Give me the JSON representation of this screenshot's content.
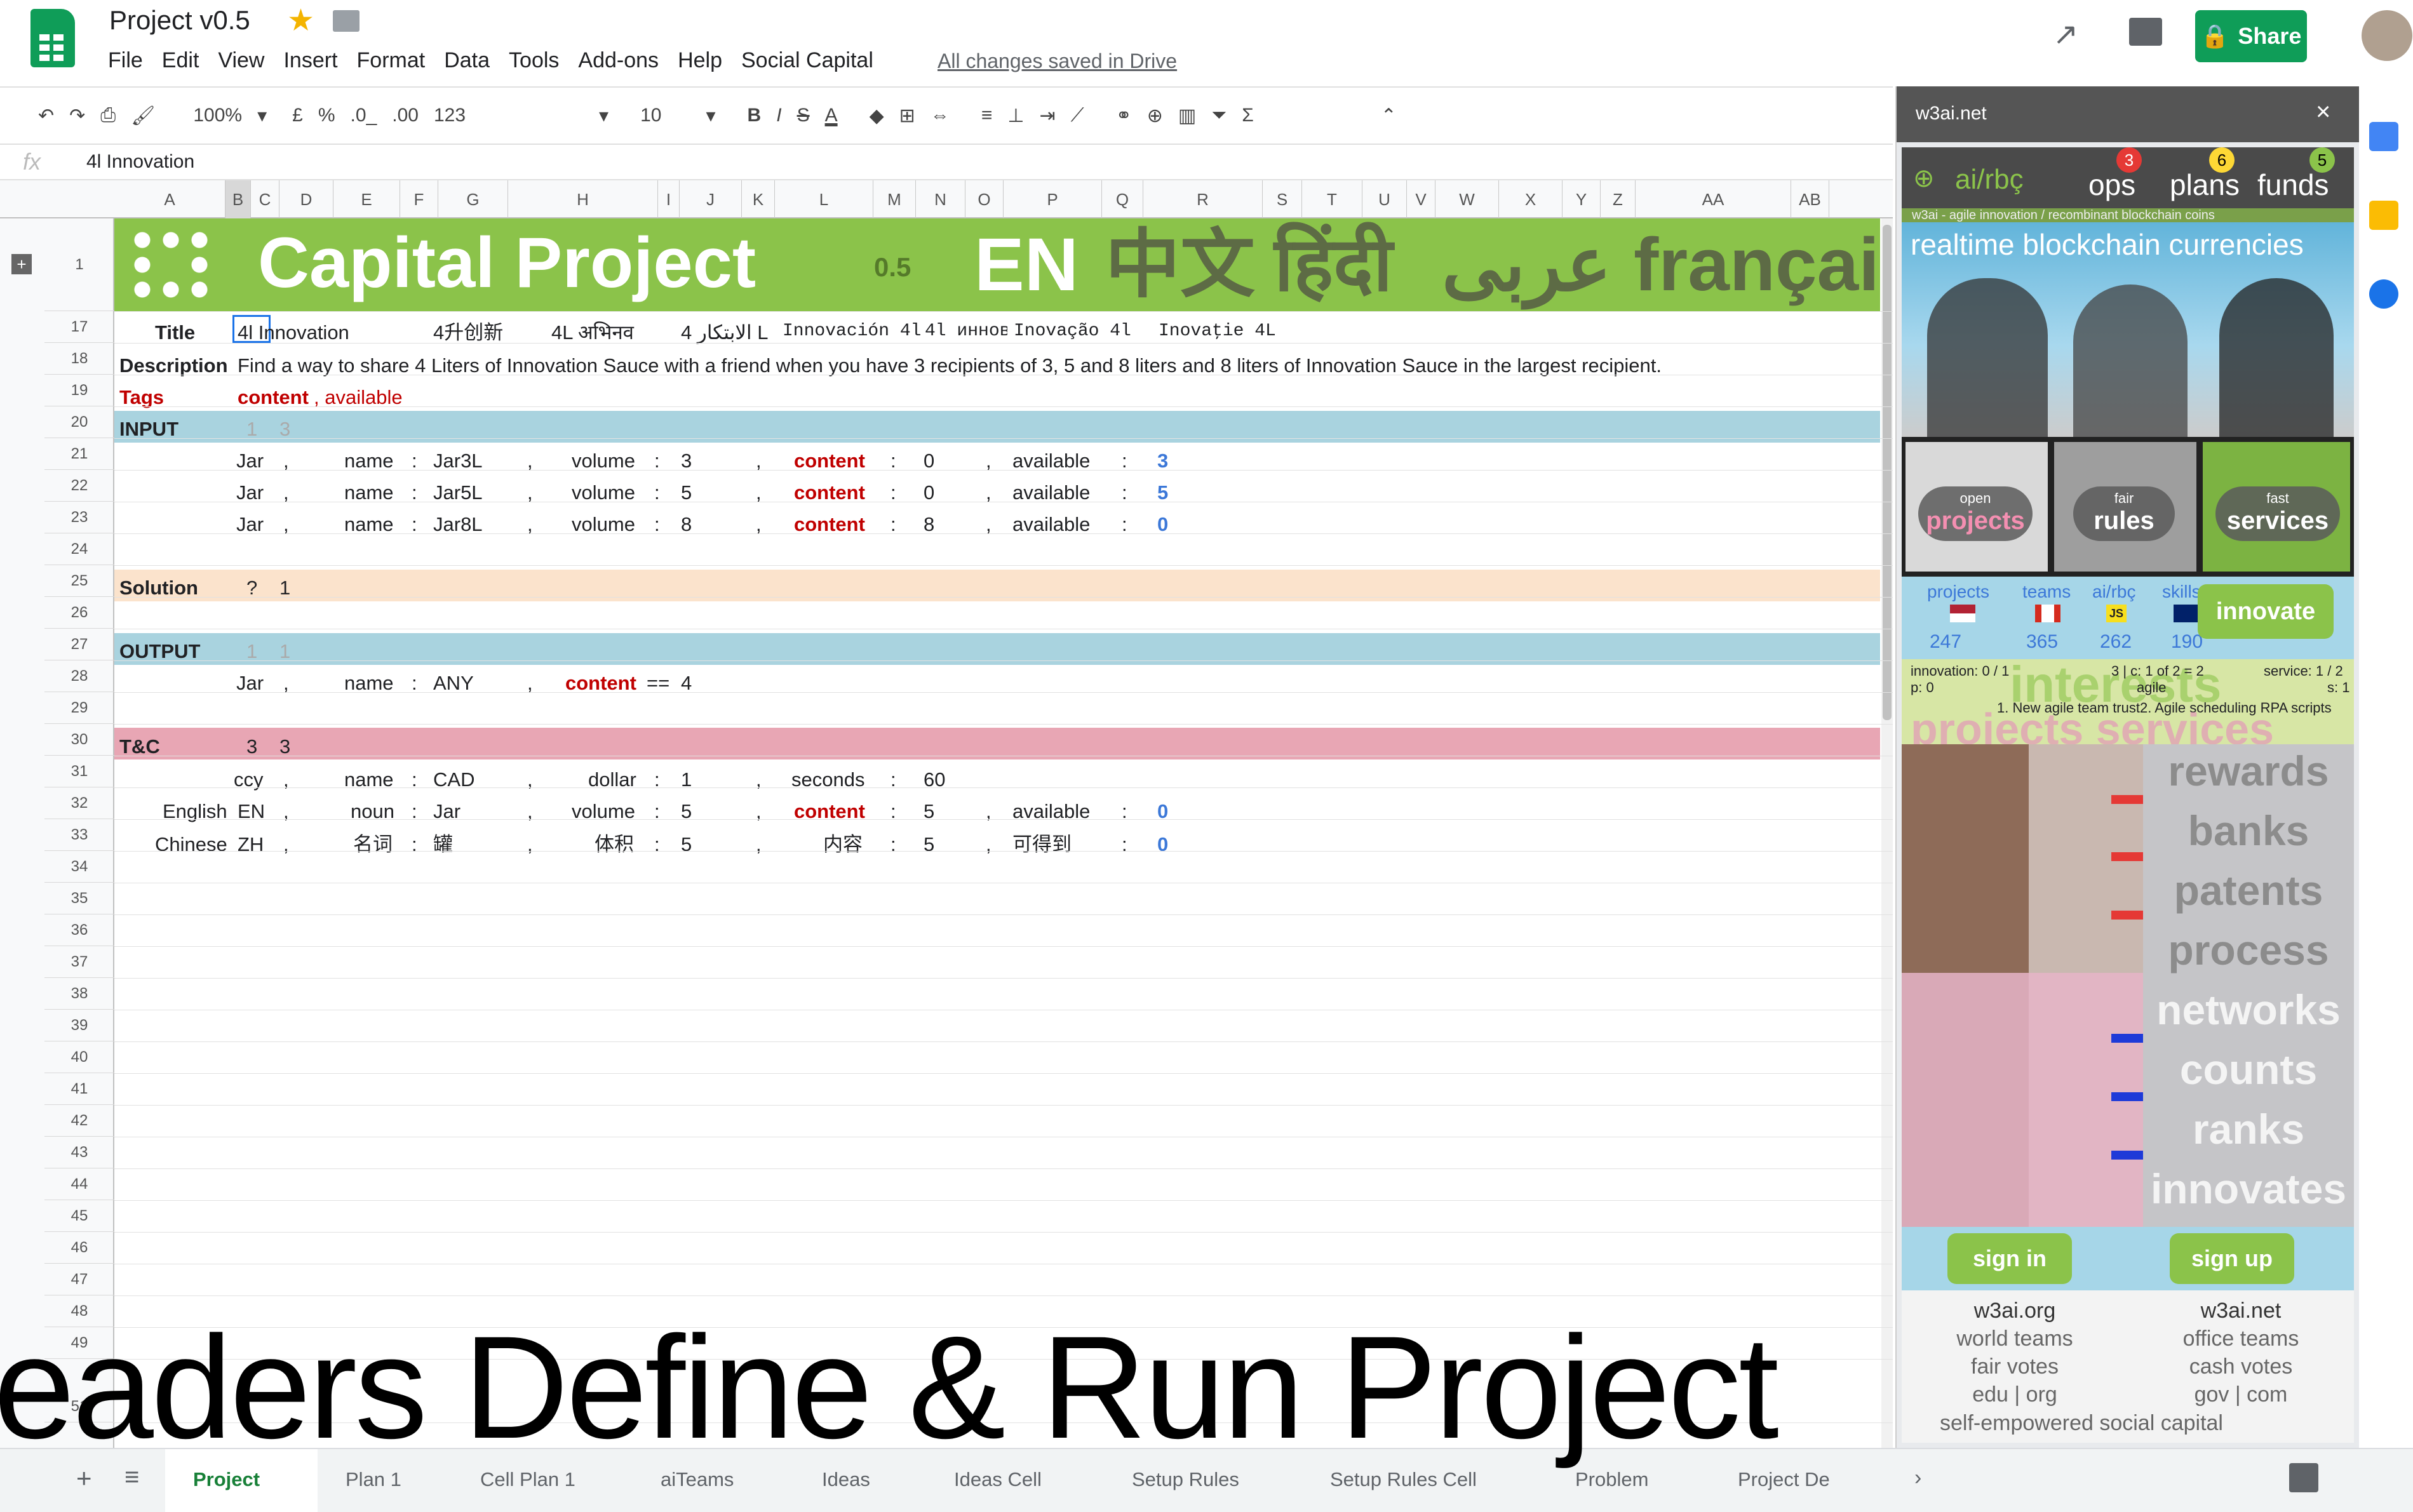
{
  "header": {
    "doc_title": "Project v0.5",
    "menus": [
      "File",
      "Edit",
      "View",
      "Insert",
      "Format",
      "Data",
      "Tools",
      "Add-ons",
      "Help",
      "Social Capital"
    ],
    "saved_status": "All changes saved in Drive",
    "share_label": "Share"
  },
  "toolbar": {
    "zoom": "100%",
    "currency": "£",
    "percent": "%",
    "dec_less": ".0_",
    "dec_more": ".00",
    "format_num": "123",
    "font_size": "10",
    "bold": "B",
    "italic": "I",
    "strike": "S",
    "text_color": "A",
    "sum": "Σ"
  },
  "formula_bar": {
    "fx": "fx",
    "value": "4l Innovation"
  },
  "columns": [
    "A",
    "B",
    "C",
    "D",
    "E",
    "F",
    "G",
    "H",
    "I",
    "J",
    "K",
    "L",
    "M",
    "N",
    "O",
    "P",
    "Q",
    "R",
    "S",
    "T",
    "U",
    "V",
    "W",
    "X",
    "Y",
    "Z",
    "AA",
    "AB"
  ],
  "banner": {
    "title": "Capital Project",
    "version": "0.5",
    "langs": [
      "EN",
      "中文",
      "हिंदी",
      "عربى",
      "françai"
    ]
  },
  "rows": {
    "r1": "1",
    "r17": "17",
    "r18": "18",
    "r19": "19",
    "r20": "20",
    "r21": "21",
    "r22": "22",
    "r23": "23",
    "r24": "24",
    "r25": "25",
    "r26": "26",
    "r27": "27",
    "r28": "28",
    "r29": "29",
    "r30": "30",
    "r31": "31",
    "r32": "32",
    "r33": "33",
    "r34": "34",
    "r35": "35",
    "r36": "36",
    "r37": "37",
    "r38": "38",
    "r39": "39",
    "r40": "40",
    "r41": "41",
    "r42": "42",
    "r43": "43",
    "r44": "44",
    "r45": "45",
    "r46": "46",
    "r47": "47",
    "r48": "48",
    "r49": "49",
    "r51": "51"
  },
  "sheet": {
    "title_label": "Title",
    "title_en": "4l Innovation",
    "title_zh": "4升创新",
    "title_hi": "4L अभिनव",
    "title_ar": "4 الابتكار L",
    "title_es": "Innovación 4l",
    "title_ru": "4l инновации",
    "title_pt": "Inovação 4l",
    "title_ro": "Inovaţie 4L",
    "desc_label": "Description",
    "desc": "Find a way to share 4 Liters of Innovation Sauce with a friend when you have 3 recipients of 3, 5 and 8 liters and 8 liters of Innovation Sauce in the largest recipient.",
    "tags_label": "Tags",
    "tags_content": "content",
    "tags_available": ", available",
    "input_label": "INPUT",
    "input_b": "1",
    "input_c": "3",
    "jar": "Jar",
    "comma": ",",
    "name": "name",
    "colon": ":",
    "volume": "volume",
    "content": "content",
    "available": "available",
    "jars": [
      {
        "name": "Jar3L",
        "volume": "3",
        "content": "0",
        "available": "3"
      },
      {
        "name": "Jar5L",
        "volume": "5",
        "content": "0",
        "available": "5"
      },
      {
        "name": "Jar8L",
        "volume": "8",
        "content": "8",
        "available": "0"
      }
    ],
    "solution_label": "Solution",
    "solution_b": "?",
    "solution_c": "1",
    "output_label": "OUTPUT",
    "output_b": "1",
    "output_c": "1",
    "output_name": "ANY",
    "output_op": "==",
    "output_val": "4",
    "tc_label": "T&C",
    "tc_b": "3",
    "tc_c": "3",
    "ccy": "ccy",
    "ccy_name": "CAD",
    "dollar": "dollar",
    "dollar_val": "1",
    "seconds": "seconds",
    "seconds_val": "60",
    "english": "English",
    "en": "EN",
    "noun": "noun",
    "en_volume": "5",
    "en_content": "5",
    "en_available": "0",
    "chinese": "Chinese",
    "zh": "ZH",
    "zh_name": "名词",
    "zh_jar": "罐",
    "zh_volume_label": "体积",
    "zh_volume": "5",
    "zh_content_label": "内容",
    "zh_content": "5",
    "zh_available_label": "可得到",
    "zh_available": "0"
  },
  "panel": {
    "host": "w3ai.net",
    "nav_brand": "ai/rbç",
    "ops": "ops",
    "plans": "plans",
    "funds": "funds",
    "badge_ops": "3",
    "badge_plans": "6",
    "badge_funds": "5",
    "banner_strip": "w3ai - agile innovation / recombinant blockchain coins",
    "tagline": "realtime blockchain currencies",
    "btn_open_small": "open",
    "btn_open": "projects",
    "btn_fair_small": "fair",
    "btn_rules": "rules",
    "btn_fast_small": "fast",
    "btn_services": "services",
    "stat_projects": "projects",
    "stat_teams": "teams",
    "stat_airbc": "ai/rbç",
    "stat_skills": "skills",
    "stat_js": "JS",
    "val_projects": "247",
    "val_teams": "365",
    "val_airbc": "262",
    "val_skills": "190",
    "innovate": "innovate",
    "info_innovation": "innovation: 0 / 1",
    "info_p": "p: 0",
    "info_mid": "3 | c: 1 of 2 = 2",
    "info_agile": "agile",
    "info_service": "service: 1 / 2",
    "info_s": "s: 1",
    "interests": "interests",
    "projects_services": "projects services",
    "info_line": "1. New agile team trust2. Agile scheduling RPA scripts",
    "words": [
      "rewards",
      "banks",
      "patents",
      "process",
      "networks",
      "counts",
      "ranks",
      "innovates"
    ],
    "sign_in": "sign in",
    "sign_up": "sign up",
    "left_col": [
      "w3ai.org",
      "world teams",
      "fair votes",
      "edu | org"
    ],
    "right_col": [
      "w3ai.net",
      "office teams",
      "cash votes",
      "gov | com"
    ],
    "bottom_partial": "self-empowered social capital"
  },
  "tabs": [
    "Project",
    "Plan 1",
    "Cell Plan 1",
    "aiTeams",
    "Ideas",
    "Ideas Cell",
    "Setup Rules",
    "Setup Rules Cell",
    "Problem",
    "Project De"
  ],
  "overlay_text": "eaders Define & Run Project",
  "colors": {
    "green": "#0f9d58",
    "banner": "#8bc34a",
    "input_band": "#a9d3df",
    "solution_band": "#fbe3cc",
    "tc_band": "#e8a6b4"
  }
}
